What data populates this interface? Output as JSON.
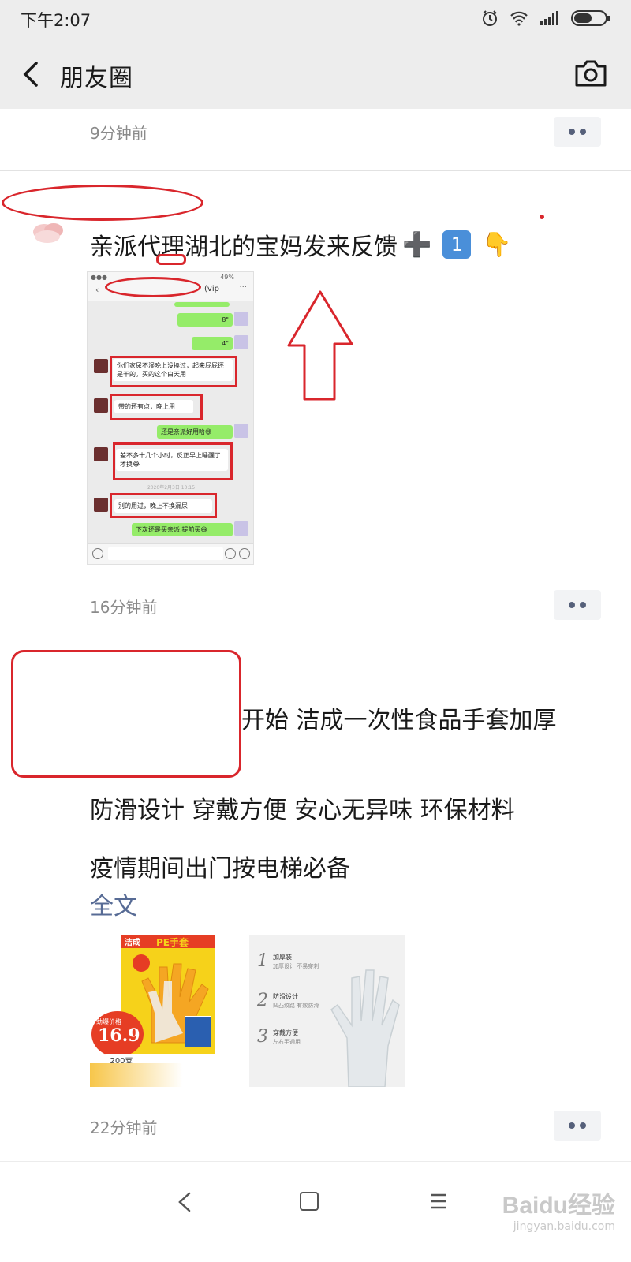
{
  "status_bar": {
    "time": "下午2:07",
    "icons": [
      "alarm-icon",
      "wifi-icon",
      "signal-icon",
      "battery-icon"
    ]
  },
  "nav": {
    "title": "朋友圈",
    "back_icon": "chevron-left-icon",
    "camera_icon": "camera-icon"
  },
  "posts": [
    {
      "time": "9分钟前"
    },
    {
      "text": "亲派代理湖北的宝妈发来反馈",
      "emojis": [
        "➕",
        "1️⃣",
        "👇"
      ],
      "time": "16分钟前",
      "image": {
        "contact_suffix": "(vip",
        "battery": "49%",
        "messages": [
          {
            "side": "out",
            "text": "8\""
          },
          {
            "side": "out",
            "text": "4\""
          },
          {
            "side": "in",
            "text": "你们家尿不湿晚上没换过，起来屁屁还是干的。买的这个白天用"
          },
          {
            "side": "in",
            "text": "带的还有点，晚上用"
          },
          {
            "side": "out",
            "text": "还是亲派好用哈😄"
          },
          {
            "side": "in",
            "text": "差不多十几个小时，反正早上睡醒了才换😂"
          },
          {
            "side": "time",
            "text": "2020年2月3日 10:15"
          },
          {
            "side": "in",
            "text": "别的用过，晚上不换漏尿"
          },
          {
            "side": "out",
            "text": "下次还是买亲派,提前买😄"
          }
        ]
      }
    },
    {
      "lines": [
        "开始  洁成一次性食品手套加厚",
        "防滑设计  穿戴方便  安心无异味   环保材料",
        "疫情期间出门按电梯必备"
      ],
      "full_text_link": "全文",
      "time": "22分钟前",
      "product_image": {
        "brand": "洁成",
        "name": "PE手套",
        "price": "16.9",
        "count": "200支",
        "tag": "劲爆价格"
      },
      "feature_image": {
        "items": [
          {
            "num": "1",
            "title": "加厚装",
            "sub": "加厚设计 不易穿刺"
          },
          {
            "num": "2",
            "title": "防滑设计",
            "sub": "凹凸纹路 有效防滑"
          },
          {
            "num": "3",
            "title": "穿戴方便",
            "sub": "左右手通用"
          }
        ]
      }
    }
  ],
  "bottom_nav": {
    "icons": [
      "back-icon",
      "home-icon",
      "menu-icon"
    ]
  },
  "watermark": {
    "line1": "Baidu经验",
    "line2": "jingyan.baidu.com"
  },
  "colors": {
    "link": "#576b95",
    "redaction": "#d9262c",
    "bar_bg": "#ededed",
    "more_dots": "#56607a"
  }
}
